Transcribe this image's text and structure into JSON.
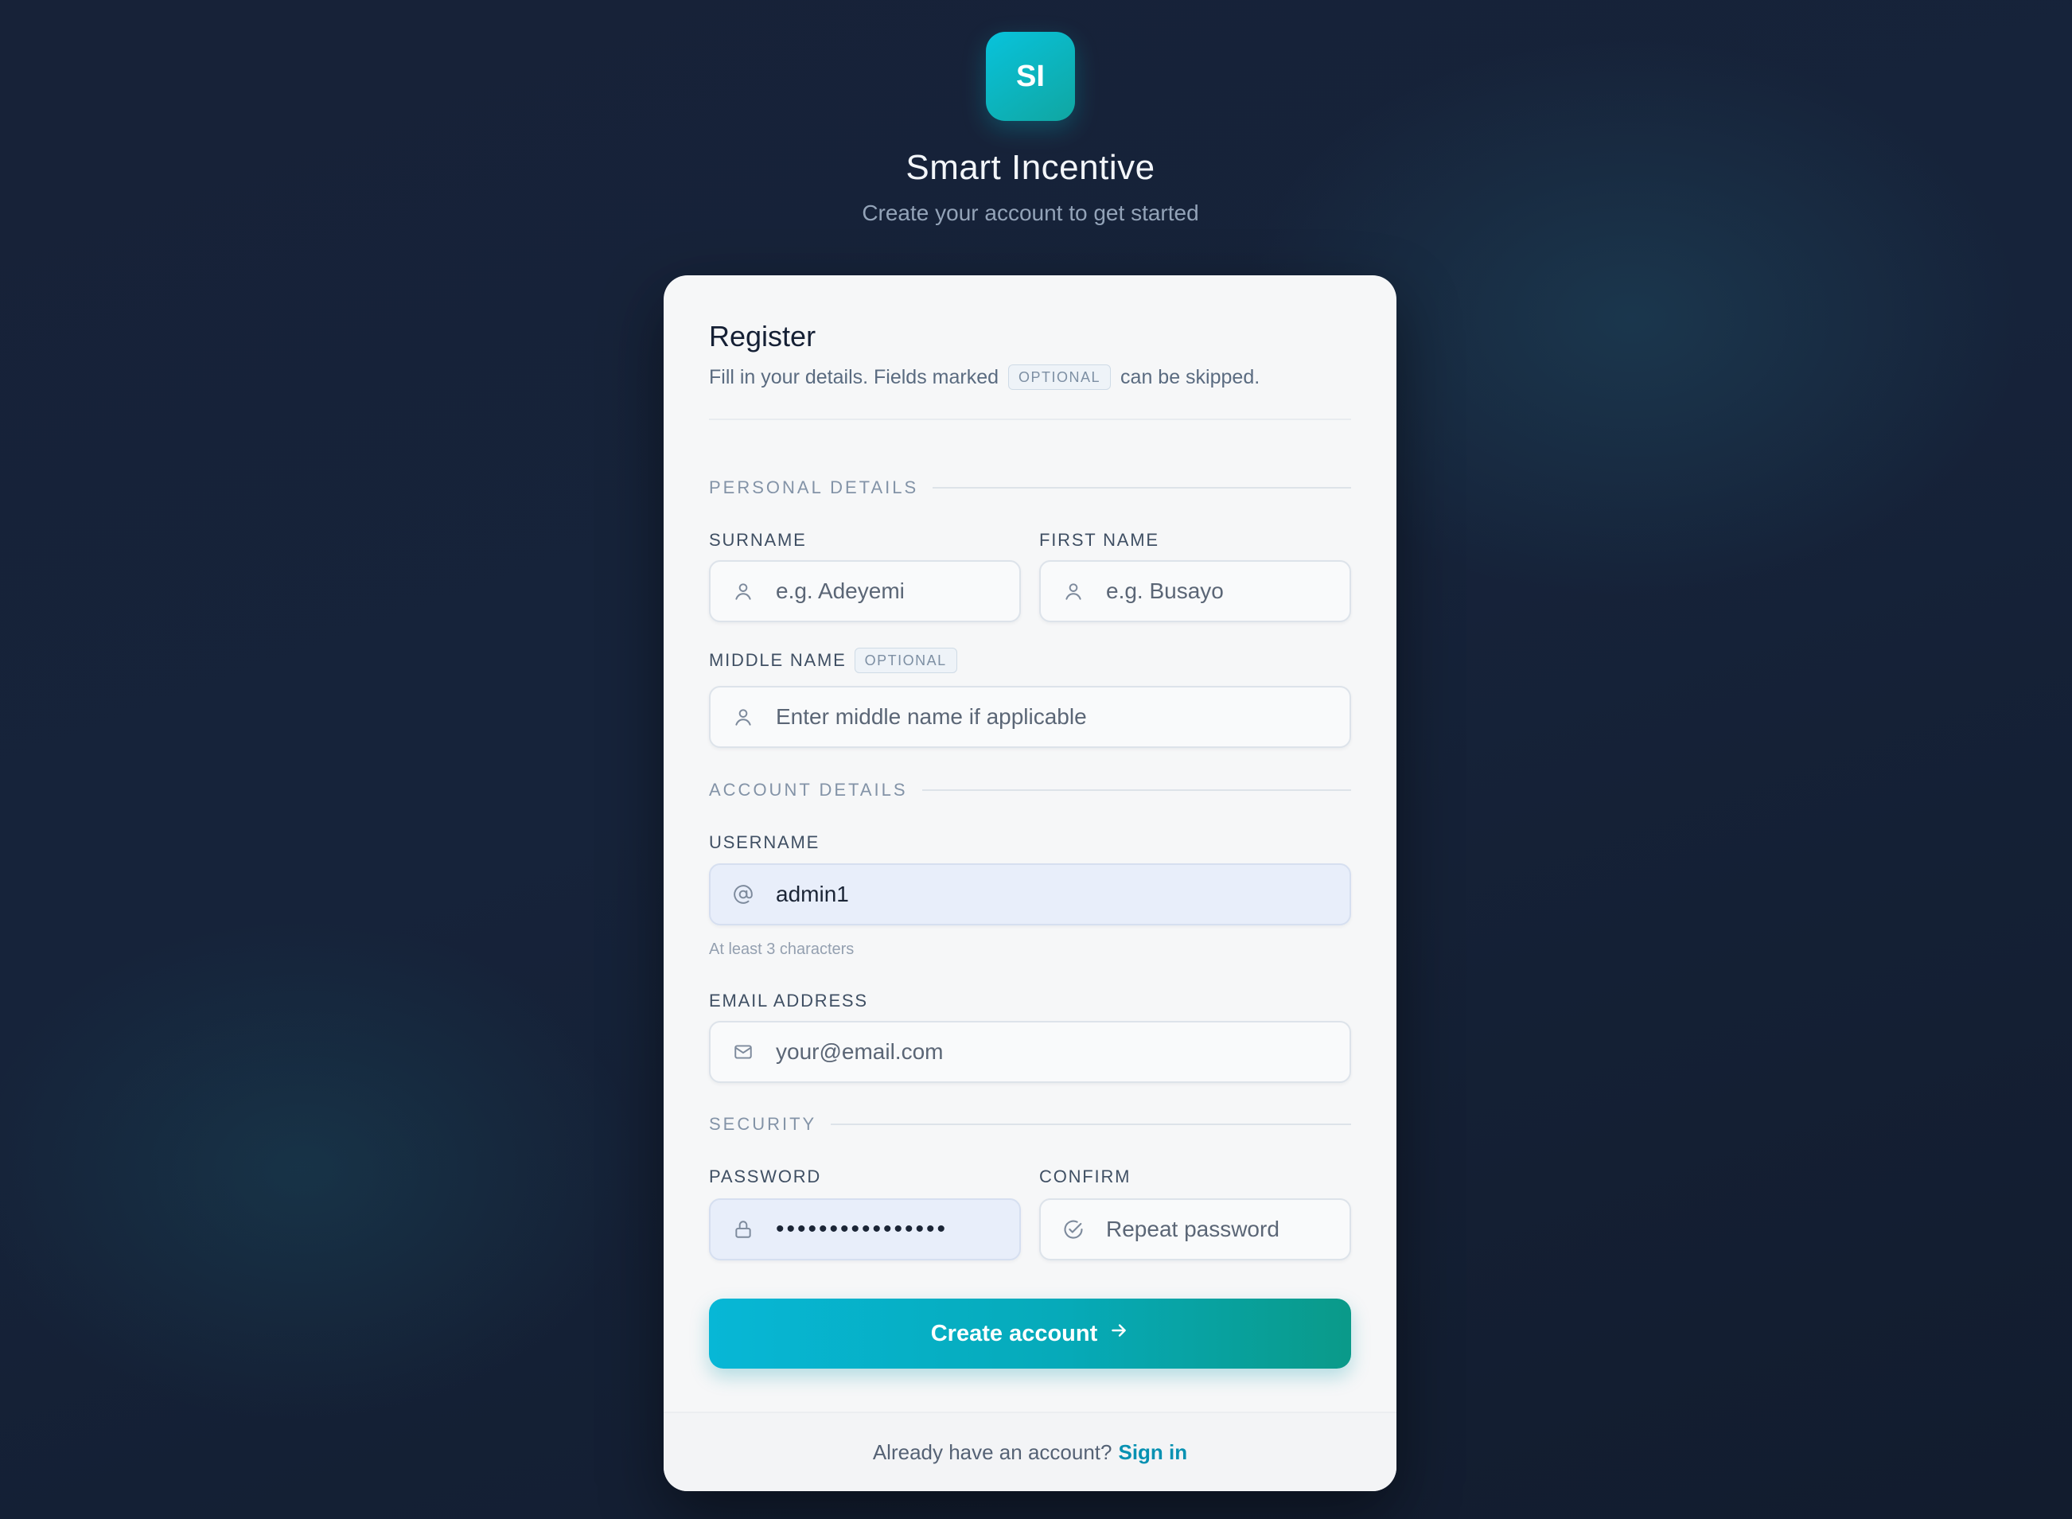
{
  "brand": {
    "logo_text": "SI",
    "title": "Smart Incentive",
    "subtitle": "Create your account to get started"
  },
  "card": {
    "title": "Register",
    "desc_before": "Fill in your details. Fields marked",
    "desc_badge": "OPTIONAL",
    "desc_after": "can be skipped."
  },
  "sections": {
    "personal": "PERSONAL DETAILS",
    "account": "ACCOUNT DETAILS",
    "security": "SECURITY"
  },
  "fields": {
    "surname": {
      "label": "SURNAME",
      "placeholder": "e.g. Adeyemi",
      "icon": "user-icon"
    },
    "first_name": {
      "label": "FIRST NAME",
      "placeholder": "e.g. Busayo",
      "icon": "user-icon"
    },
    "middle_name": {
      "label": "MIDDLE NAME",
      "badge": "OPTIONAL",
      "placeholder": "Enter middle name if applicable",
      "icon": "user-icon"
    },
    "username": {
      "label": "USERNAME",
      "value": "admin1",
      "hint": "At least 3 characters",
      "icon": "at-sign-icon"
    },
    "email": {
      "label": "EMAIL ADDRESS",
      "placeholder": "your@email.com",
      "icon": "mail-icon"
    },
    "password": {
      "label": "PASSWORD",
      "value": "••••••••••••••••",
      "icon": "lock-icon"
    },
    "confirm": {
      "label": "CONFIRM",
      "placeholder": "Repeat password",
      "icon": "check-circle-icon"
    }
  },
  "submit": {
    "label": "Create account",
    "icon": "arrow-right-icon"
  },
  "footer": {
    "text": "Already have an account?",
    "link": "Sign in"
  },
  "colors": {
    "accent_start": "#07b7d6",
    "accent_end": "#0a9a89",
    "link": "#0891b2",
    "page_bg": "#16233a",
    "card_bg": "#f6f7f8",
    "filled_field_bg": "#e8eefa"
  }
}
